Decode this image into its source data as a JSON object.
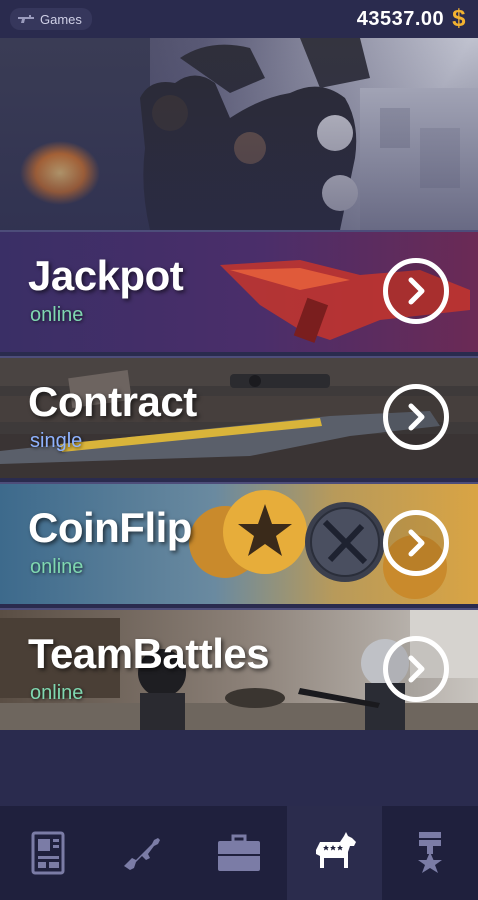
{
  "header": {
    "games_label": "Games",
    "balance": "43537.00",
    "currency_symbol": "$"
  },
  "modes": [
    {
      "title": "Jackpot",
      "status": "online",
      "status_color": "#7fd7b0"
    },
    {
      "title": "Contract",
      "status": "single",
      "status_color": "#8fb3ff"
    },
    {
      "title": "CoinFlip",
      "status": "online",
      "status_color": "#7fd7b0"
    },
    {
      "title": "TeamBattles",
      "status": "online",
      "status_color": "#7fd7b0"
    }
  ],
  "bottom_nav": {
    "items": [
      "id-card-icon",
      "rifle-icon",
      "briefcase-icon",
      "donkey-icon",
      "medal-icon"
    ],
    "active_index": 3
  },
  "colors": {
    "background": "#2a2b4e",
    "nav_background": "#1f203d",
    "currency": "#f2b230",
    "icon": "#7b7ca6",
    "active_icon": "#ffffff"
  }
}
